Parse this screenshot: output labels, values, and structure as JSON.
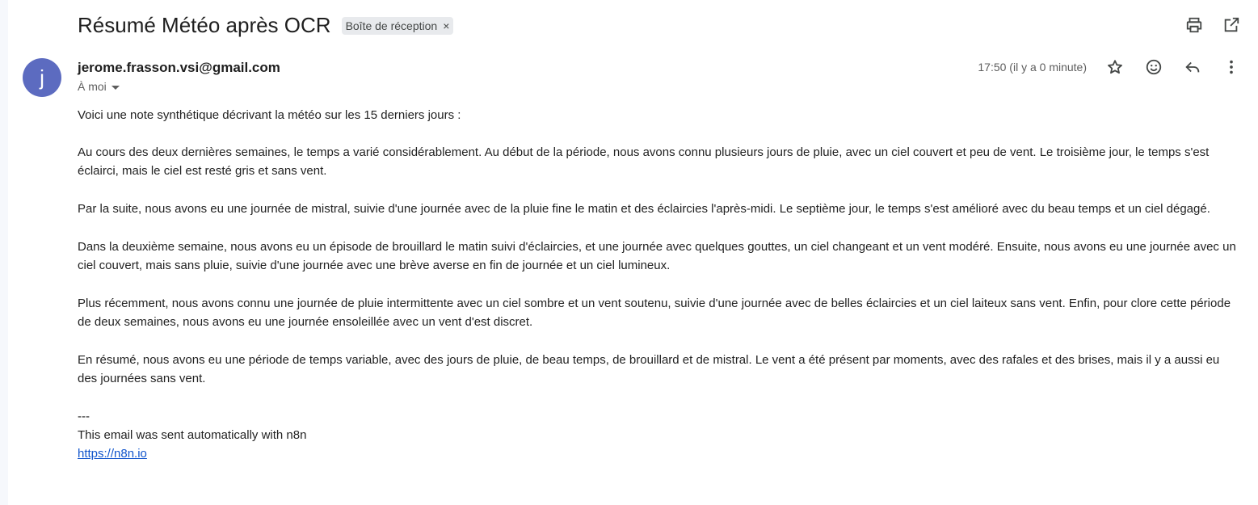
{
  "email": {
    "subject": "Résumé Météo après OCR",
    "label": "Boîte de réception",
    "label_close": "×",
    "avatar_letter": "j",
    "sender": "jerome.frasson.vsi@gmail.com",
    "recipient": "À moi",
    "timestamp": "17:50 (il y a 0 minute)",
    "body": {
      "intro": "Voici une note synthétique décrivant la météo sur les 15 derniers jours :",
      "p1": "Au cours des deux dernières semaines, le temps a varié considérablement. Au début de la période, nous avons connu plusieurs jours de pluie, avec un ciel couvert et peu de vent. Le troisième jour, le temps s'est éclairci, mais le ciel est resté gris et sans vent.",
      "p2": "Par la suite, nous avons eu une journée de mistral, suivie d'une journée avec de la pluie fine le matin et des éclaircies l'après-midi. Le septième jour, le temps s'est amélioré avec du beau temps et un ciel dégagé.",
      "p3": "Dans la deuxième semaine, nous avons eu un épisode de brouillard le matin suivi d'éclaircies, et une journée avec quelques gouttes, un ciel changeant et un vent modéré. Ensuite, nous avons eu une journée avec un ciel couvert, mais sans pluie, suivie d'une journée avec une brève averse en fin de journée et un ciel lumineux.",
      "p4": "Plus récemment, nous avons connu une journée de pluie intermittente avec un ciel sombre et un vent soutenu, suivie d'une journée avec de belles éclaircies et un ciel laiteux sans vent. Enfin, pour clore cette période de deux semaines, nous avons eu une journée ensoleillée avec un vent d'est discret.",
      "p5": "En résumé, nous avons eu une période de temps variable, avec des jours de pluie, de beau temps, de brouillard et de mistral. Le vent a été présent par moments, avec des rafales et des brises, mais il y a aussi eu des journées sans vent."
    },
    "signature": {
      "separator": "---",
      "line": "This email was sent automatically with n8n",
      "link": "https://n8n.io"
    }
  },
  "icons": {
    "print": "print-icon",
    "open_new_window": "open-in-new-window-icon",
    "star": "star-icon",
    "emoji": "emoji-reaction-icon",
    "reply": "reply-icon",
    "more": "more-vertical-icon"
  },
  "colors": {
    "avatar": "#5c6bc0",
    "link": "#1155cc",
    "chip": "#e8eaed"
  }
}
